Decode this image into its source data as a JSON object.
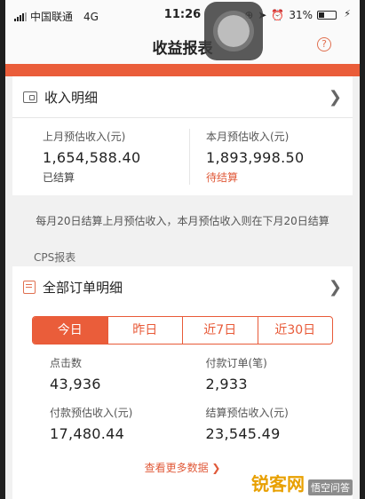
{
  "status_bar": {
    "carrier": "中国联通",
    "network": "4G",
    "time": "11:26",
    "battery": "31%"
  },
  "nav": {
    "title": "收益报表",
    "help_glyph": "?"
  },
  "income_card": {
    "header_label": "收入明细",
    "last_month_label": "上月预估收入(元)",
    "last_month_value": "1,654,588.40",
    "last_month_status": "已结算",
    "this_month_label": "本月预估收入(元)",
    "this_month_value": "1,893,998.50",
    "this_month_status": "待结算"
  },
  "notice": "每月20日结算上月预估收入，本月预估收入则在下月20日结算",
  "cps_section_label": "CPS报表",
  "orders_card": {
    "header_label": "全部订单明细",
    "tabs": [
      {
        "label": "今日",
        "active": true
      },
      {
        "label": "昨日",
        "active": false
      },
      {
        "label": "近7日",
        "active": false
      },
      {
        "label": "近30日",
        "active": false
      }
    ],
    "stats": [
      {
        "label": "点击数",
        "value": "43,936"
      },
      {
        "label": "付款订单(笔)",
        "value": "2,933"
      },
      {
        "label": "付款预估收入(元)",
        "value": "17,480.44"
      },
      {
        "label": "结算预估收入(元)",
        "value": "23,545.49"
      }
    ],
    "more_link": "查看更多数据 ❯"
  },
  "watermark": {
    "brand": "锐客网",
    "sub": "悟空问答"
  },
  "colors": {
    "accent": "#ea5d3a",
    "pending": "#e05a3a"
  },
  "icons": [
    "signal-icon",
    "location-icon",
    "alarm-icon",
    "battery-icon",
    "wallet-icon",
    "document-icon",
    "chevron-right-icon",
    "help-icon"
  ]
}
